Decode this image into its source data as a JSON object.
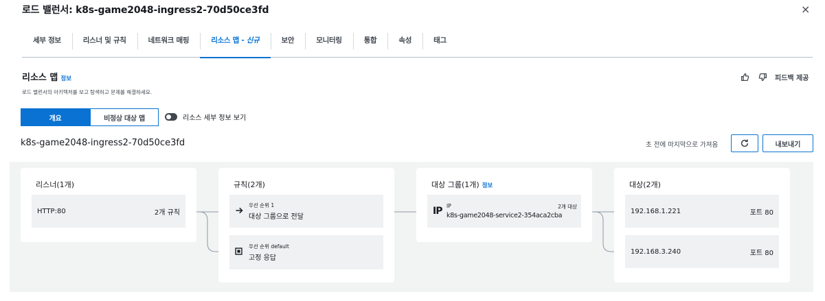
{
  "header": {
    "title": "로드 밸런서: k8s-game2048-ingress2-70d50ce3fd",
    "close_icon": "×"
  },
  "tabs": [
    {
      "label": "세부 정보"
    },
    {
      "label": "리스너 및 규칙"
    },
    {
      "label": "네트워크 매핑"
    },
    {
      "label": "리소스 맵 - ",
      "suffix": "신규",
      "active": true
    },
    {
      "label": "보안"
    },
    {
      "label": "모니터링"
    },
    {
      "label": "통합"
    },
    {
      "label": "속성"
    },
    {
      "label": "태그"
    }
  ],
  "section": {
    "title": "리소스 맵",
    "info": "정보",
    "description": "로드 밸런서의 아키텍처를 보고 탐색하고 문제를 해결하세요.",
    "feedback": "피드백 제공"
  },
  "view": {
    "overview": "개요",
    "unhealthy": "비정상 대상 맵",
    "toggle_label": "리소스 세부 정보 보기"
  },
  "lb_name": "k8s-game2048-ingress2-70d50ce3fd",
  "refreshed": "초 전에 마지막으로 가져옴",
  "export": "내보내기",
  "colors": {
    "accent": "#0972d3",
    "text": "#16191f",
    "canvas": "#f2f3f3"
  },
  "map": {
    "listeners": {
      "title": "리스너(1개)",
      "items": [
        {
          "name": "HTTP:80",
          "count": "2개 규칙"
        }
      ]
    },
    "rules": {
      "title": "규칙(2개)",
      "items": [
        {
          "priority": "우선 순위 1",
          "action": "대상 그룹으로 전달",
          "icon": "arrow-right-icon"
        },
        {
          "priority": "우선 순위 default",
          "action": "고정 응답",
          "icon": "fixed-response-icon"
        }
      ]
    },
    "target_groups": {
      "title": "대상 그룹(1개)",
      "info": "정보",
      "items": [
        {
          "type": "IP",
          "count": "2개 대상",
          "name": "k8s-game2048-service2-354aca2cba"
        }
      ]
    },
    "targets": {
      "title": "대상(2개)",
      "items": [
        {
          "ip": "192.168.1.221",
          "port": "포트 80"
        },
        {
          "ip": "192.168.3.240",
          "port": "포트 80"
        }
      ]
    }
  }
}
